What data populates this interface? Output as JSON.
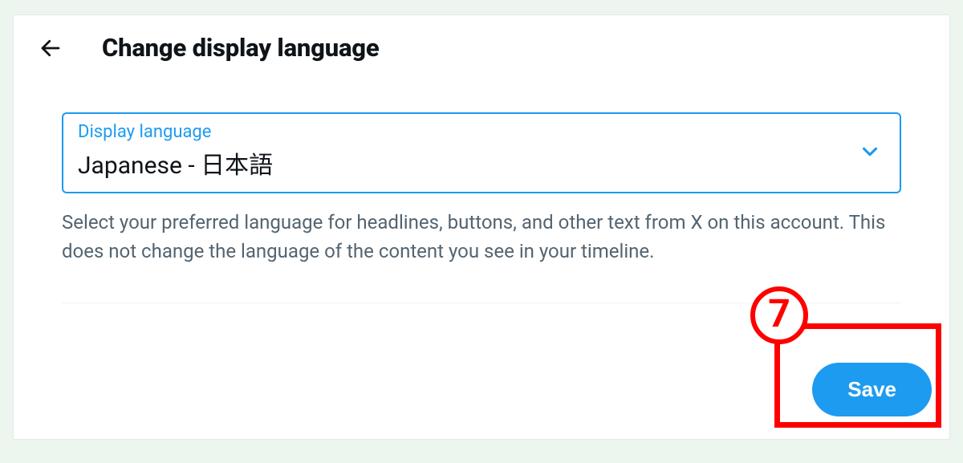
{
  "header": {
    "title": "Change display language"
  },
  "select": {
    "label": "Display language",
    "value": "Japanese - 日本語"
  },
  "help_text": "Select your preferred language for headlines, buttons, and other text from X on this account. This does not change the language of the content you see in your timeline.",
  "footer": {
    "save_label": "Save"
  },
  "annotation": {
    "step_number": "7"
  }
}
